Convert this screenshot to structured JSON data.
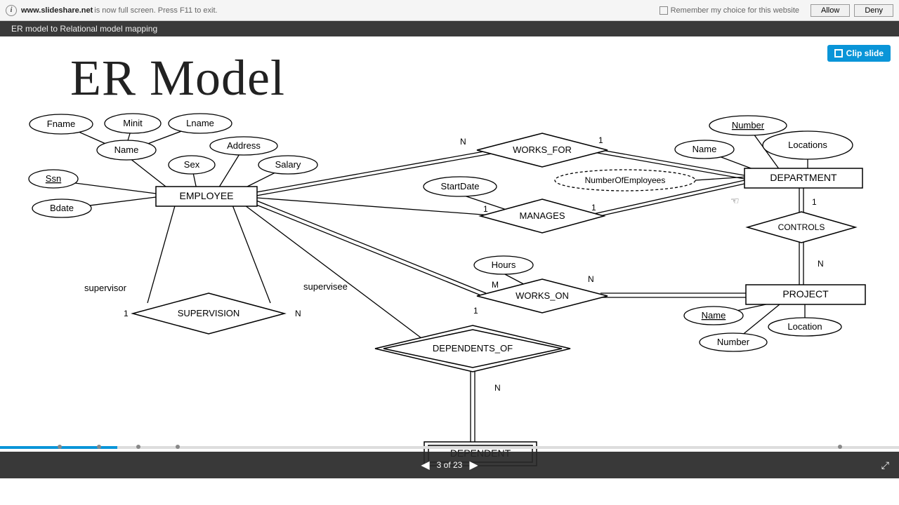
{
  "topbar": {
    "domain": "www.slideshare.net",
    "message": " is now full screen. Press F11 to exit.",
    "remember": "Remember my choice for this website",
    "allow": "Allow",
    "deny": "Deny"
  },
  "presentation": {
    "title": "ER model to Relational model mapping"
  },
  "clip": {
    "label": "Clip slide"
  },
  "slide": {
    "heading": "ER Model"
  },
  "nav": {
    "counter": "3 of 23",
    "current": 3,
    "total": 23
  },
  "er": {
    "entities": {
      "employee": "EMPLOYEE",
      "department": "DEPARTMENT",
      "project": "PROJECT",
      "dependent": "DEPENDENT"
    },
    "relationships": {
      "works_for": "WORKS_FOR",
      "manages": "MANAGES",
      "controls": "CONTROLS",
      "works_on": "WORKS_ON",
      "supervision": "SUPERVISION",
      "dependents_of": "DEPENDENTS_OF"
    },
    "attributes": {
      "fname": "Fname",
      "minit": "Minit",
      "lname": "Lname",
      "name": "Name",
      "ssn": "Ssn",
      "bdate": "Bdate",
      "sex": "Sex",
      "address": "Address",
      "salary": "Salary",
      "dept_number": "Number",
      "dept_name": "Name",
      "locations": "Locations",
      "num_emp": "NumberOfEmployees",
      "startdate": "StartDate",
      "hours": "Hours",
      "proj_name": "Name",
      "proj_location": "Location",
      "proj_number": "Number"
    },
    "roles": {
      "supervisor": "supervisor",
      "supervisee": "supervisee"
    },
    "cardinalities": {
      "one": "1",
      "n": "N",
      "m": "M"
    }
  }
}
